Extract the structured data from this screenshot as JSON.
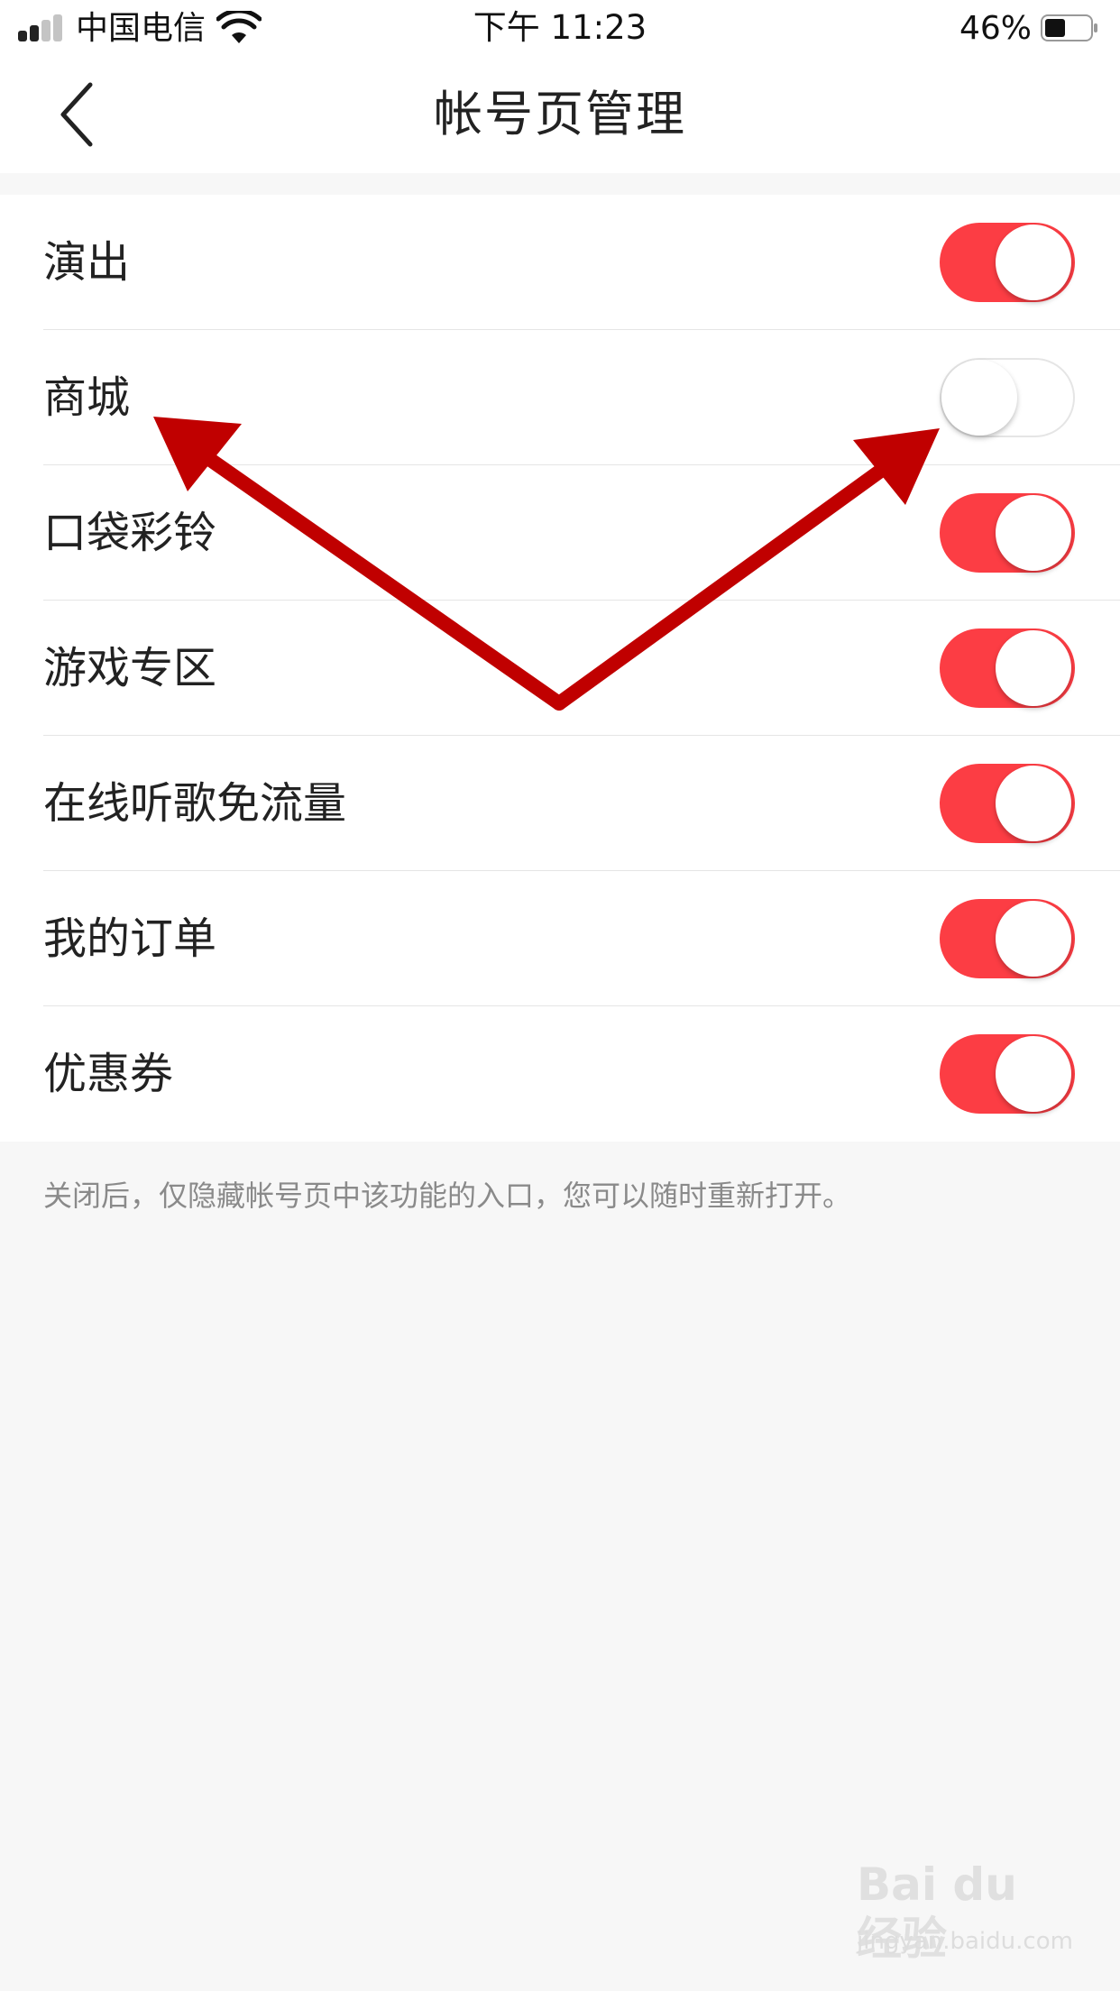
{
  "status_bar": {
    "carrier": "中国电信",
    "time": "下午 11:23",
    "battery_percent": "46%",
    "battery_level": 0.46,
    "icons": [
      "signal-icon",
      "wifi-icon",
      "battery-icon"
    ]
  },
  "nav": {
    "title": "帐号页管理",
    "back_icon": "chevron-left-icon"
  },
  "settings": [
    {
      "label": "演出",
      "enabled": true
    },
    {
      "label": "商城",
      "enabled": false
    },
    {
      "label": "口袋彩铃",
      "enabled": true
    },
    {
      "label": "游戏专区",
      "enabled": true
    },
    {
      "label": "在线听歌免流量",
      "enabled": true
    },
    {
      "label": "我的订单",
      "enabled": true
    },
    {
      "label": "优惠券",
      "enabled": true
    }
  ],
  "footer_note": "关闭后，仅隐藏帐号页中该功能的入口，您可以随时重新打开。",
  "watermark": {
    "brand": "Bai du 经验",
    "domain": "jingyan.baidu.com"
  },
  "colors": {
    "toggle_on": "#fc3d44",
    "annotation_arrow": "#c00000",
    "background": "#f7f7f7"
  }
}
